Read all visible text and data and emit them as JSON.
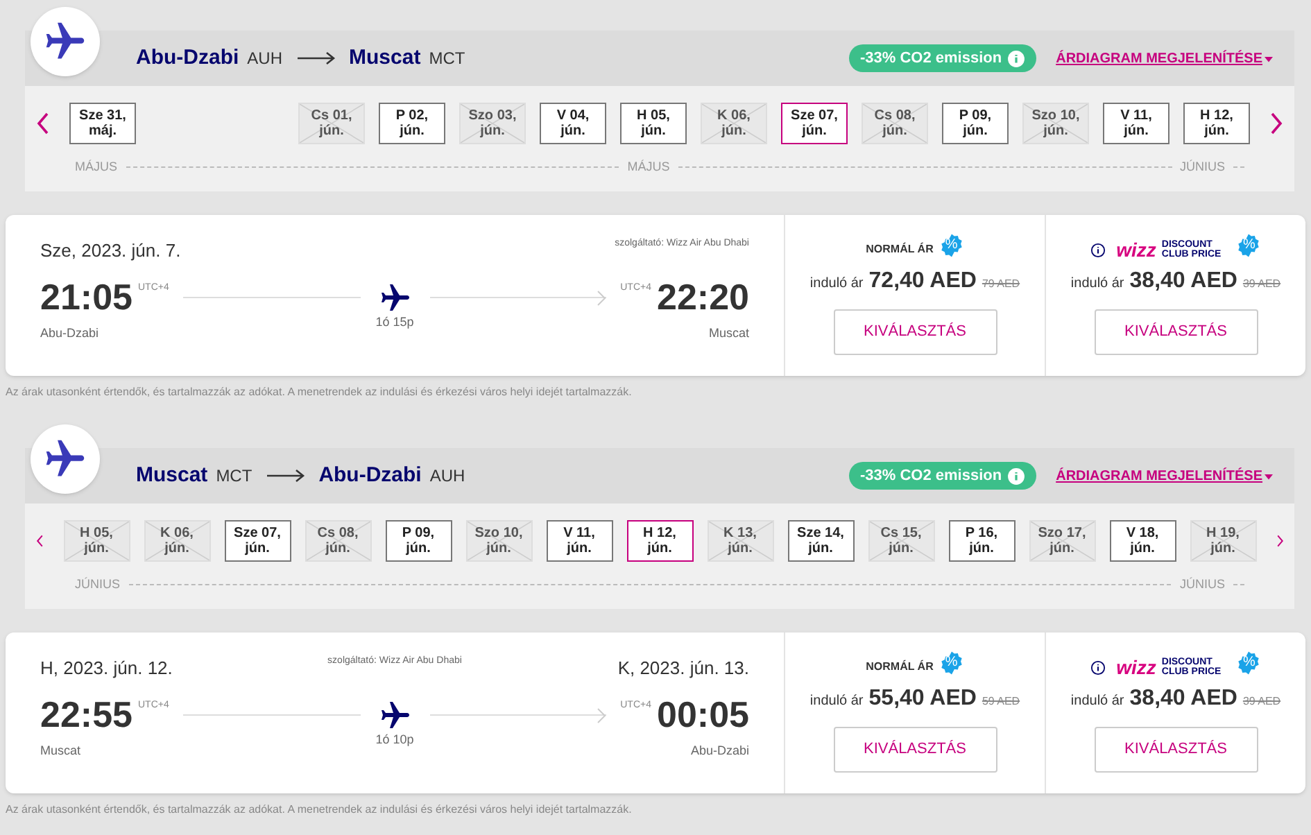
{
  "journeys": [
    {
      "origin": {
        "city": "Abu-Dzabi",
        "code": "AUH"
      },
      "destination": {
        "city": "Muscat",
        "code": "MCT"
      },
      "co2_badge": "-33% CO2 emission",
      "chart_link": "ÁRDIAGRAM MEGJELENÍTÉSE",
      "date_groups": [
        {
          "chips": [
            {
              "day": "Sze 31,",
              "month": "máj.",
              "available": true,
              "selected": false
            }
          ]
        },
        {
          "chips": [
            {
              "day": "Cs 01,",
              "month": "jún.",
              "available": false,
              "selected": false
            },
            {
              "day": "P 02,",
              "month": "jún.",
              "available": true,
              "selected": false
            },
            {
              "day": "Szo 03,",
              "month": "jún.",
              "available": false,
              "selected": false
            },
            {
              "day": "V 04,",
              "month": "jún.",
              "available": true,
              "selected": false
            },
            {
              "day": "H 05,",
              "month": "jún.",
              "available": true,
              "selected": false
            },
            {
              "day": "K 06,",
              "month": "jún.",
              "available": false,
              "selected": false
            },
            {
              "day": "Sze 07,",
              "month": "jún.",
              "available": true,
              "selected": true
            },
            {
              "day": "Cs 08,",
              "month": "jún.",
              "available": false,
              "selected": false
            },
            {
              "day": "P 09,",
              "month": "jún.",
              "available": true,
              "selected": false
            },
            {
              "day": "Szo 10,",
              "month": "jún.",
              "available": false,
              "selected": false
            },
            {
              "day": "V 11,",
              "month": "jún.",
              "available": true,
              "selected": false
            },
            {
              "day": "H 12,",
              "month": "jún.",
              "available": true,
              "selected": false
            }
          ]
        }
      ],
      "month_labels": [
        "MÁJUS",
        "MÁJUS",
        "JÚNIUS"
      ],
      "flight": {
        "departure_date": "Sze, 2023. jún. 7.",
        "operator": "szolgáltató: Wizz Air Abu Dhabi",
        "departure_time": "21:05",
        "departure_tz": "UTC+4",
        "arrival_tz": "UTC+4",
        "arrival_time": "22:20",
        "departure_city": "Abu-Dzabi",
        "arrival_city": "Muscat",
        "duration": "1ó 15p"
      },
      "fares": [
        {
          "kind": "normal",
          "label": "NORMÁL ÁR",
          "badge": "%",
          "prefix": "induló ár",
          "price": "72,40 AED",
          "old_price": "79 AED",
          "button": "KIVÁLASZTÁS"
        },
        {
          "kind": "club",
          "logo": "wizz",
          "label": "DISCOUNT CLUB PRICE",
          "badge": "%",
          "prefix": "induló ár",
          "price": "38,40 AED",
          "old_price": "39 AED",
          "button": "KIVÁLASZTÁS"
        }
      ],
      "note": "Az árak utasonként értendők, és tartalmazzák az adókat. A menetrendek az indulási és érkezési város helyi idejét tartalmazzák."
    },
    {
      "origin": {
        "city": "Muscat",
        "code": "MCT"
      },
      "destination": {
        "city": "Abu-Dzabi",
        "code": "AUH"
      },
      "co2_badge": "-33% CO2 emission",
      "chart_link": "ÁRDIAGRAM MEGJELENÍTÉSE",
      "date_groups": [
        {
          "chips": [
            {
              "day": "H 05,",
              "month": "jún.",
              "available": false,
              "selected": false
            },
            {
              "day": "K 06,",
              "month": "jún.",
              "available": false,
              "selected": false
            },
            {
              "day": "Sze 07,",
              "month": "jún.",
              "available": true,
              "selected": false
            },
            {
              "day": "Cs 08,",
              "month": "jún.",
              "available": false,
              "selected": false
            },
            {
              "day": "P 09,",
              "month": "jún.",
              "available": true,
              "selected": false
            },
            {
              "day": "Szo 10,",
              "month": "jún.",
              "available": false,
              "selected": false
            },
            {
              "day": "V 11,",
              "month": "jún.",
              "available": true,
              "selected": false
            },
            {
              "day": "H 12,",
              "month": "jún.",
              "available": true,
              "selected": true
            },
            {
              "day": "K 13,",
              "month": "jún.",
              "available": false,
              "selected": false
            },
            {
              "day": "Sze 14,",
              "month": "jún.",
              "available": true,
              "selected": false
            },
            {
              "day": "Cs 15,",
              "month": "jún.",
              "available": false,
              "selected": false
            },
            {
              "day": "P 16,",
              "month": "jún.",
              "available": true,
              "selected": false
            },
            {
              "day": "Szo 17,",
              "month": "jún.",
              "available": false,
              "selected": false
            },
            {
              "day": "V 18,",
              "month": "jún.",
              "available": true,
              "selected": false
            },
            {
              "day": "H 19,",
              "month": "jún.",
              "available": false,
              "selected": false
            }
          ]
        }
      ],
      "month_labels": [
        "JÚNIUS",
        "JÚNIUS"
      ],
      "flight": {
        "departure_date": "H, 2023. jún. 12.",
        "operator": "szolgáltató: Wizz Air Abu Dhabi",
        "arrival_date": "K, 2023. jún. 13.",
        "departure_time": "22:55",
        "departure_tz": "UTC+4",
        "arrival_tz": "UTC+4",
        "arrival_time": "00:05",
        "departure_city": "Muscat",
        "arrival_city": "Abu-Dzabi",
        "duration": "1ó 10p"
      },
      "fares": [
        {
          "kind": "normal",
          "label": "NORMÁL ÁR",
          "badge": "%",
          "prefix": "induló ár",
          "price": "55,40 AED",
          "old_price": "59 AED",
          "button": "KIVÁLASZTÁS"
        },
        {
          "kind": "club",
          "logo": "wizz",
          "label": "DISCOUNT CLUB PRICE",
          "badge": "%",
          "prefix": "induló ár",
          "price": "38,40 AED",
          "old_price": "39 AED",
          "button": "KIVÁLASZTÁS"
        }
      ],
      "note": "Az árak utasonként értendők, és tartalmazzák az adókat. A menetrendek az indulási és érkezési város helyi idejét tartalmazzák."
    }
  ]
}
